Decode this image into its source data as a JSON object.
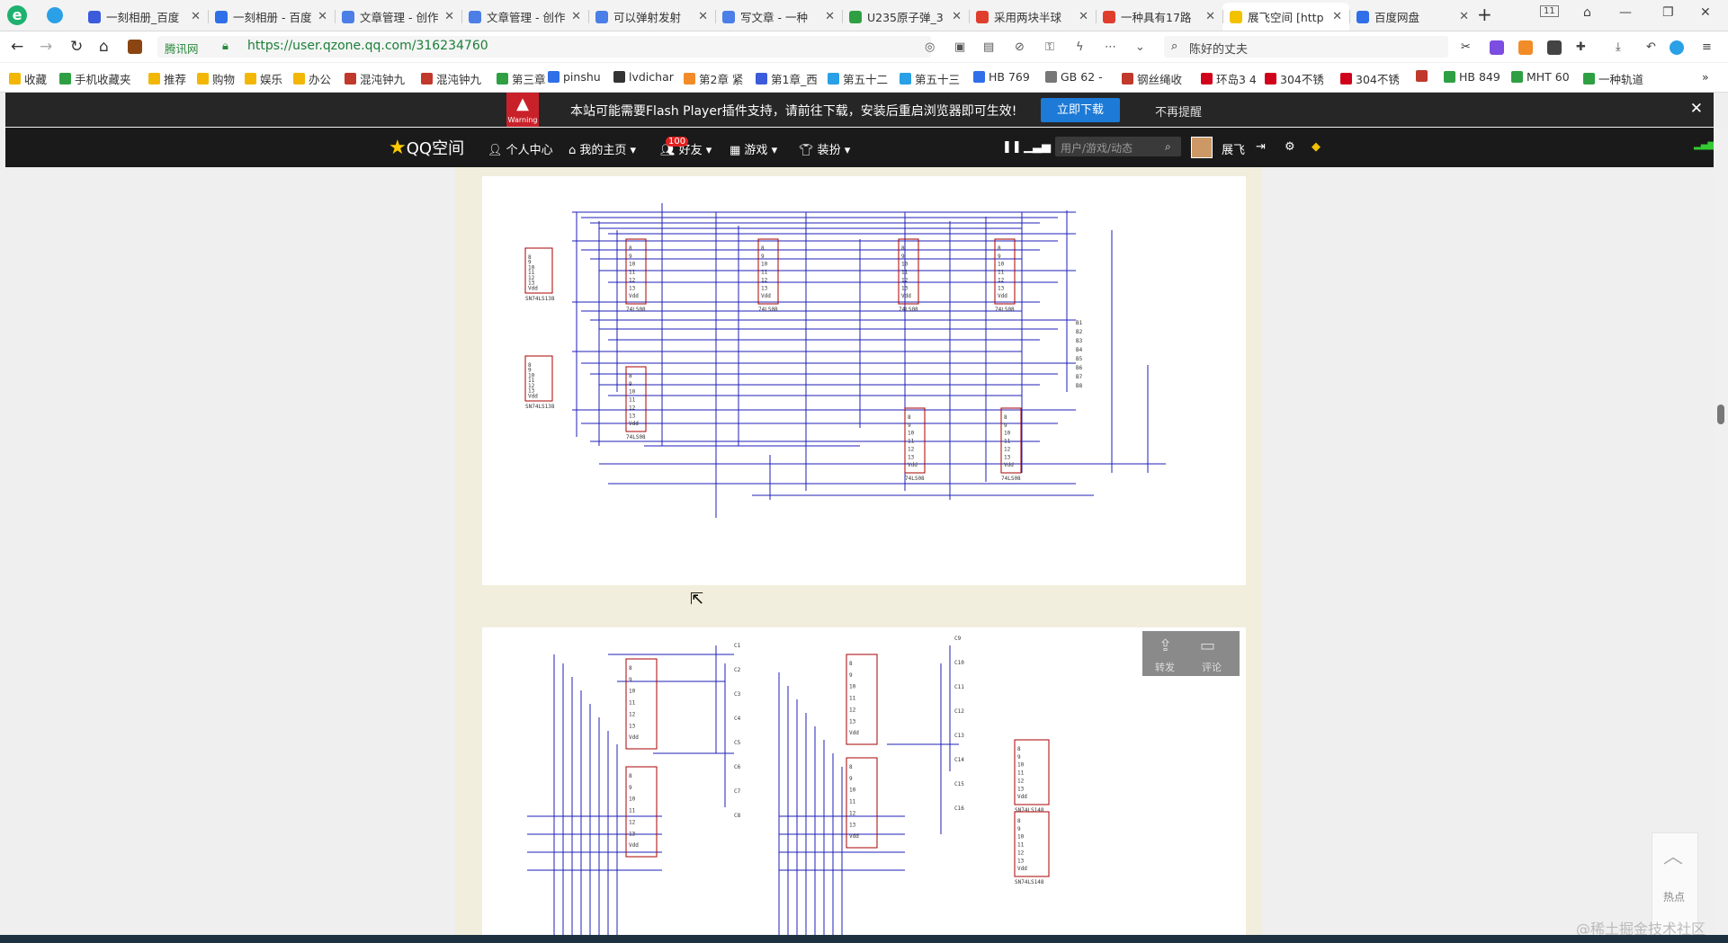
{
  "tabs": [
    {
      "title": "一刻相册_百度",
      "color": "#3b5bdb",
      "active": false
    },
    {
      "title": "一刻相册 - 百度",
      "color": "#2f6fe8",
      "active": false
    },
    {
      "title": "文章管理 - 创作",
      "color": "#4c7ee8",
      "active": false
    },
    {
      "title": "文章管理 - 创作",
      "color": "#4c7ee8",
      "active": false
    },
    {
      "title": "可以弹射发射",
      "color": "#4c7ee8",
      "active": false
    },
    {
      "title": "写文章 - 一种",
      "color": "#4c7ee8",
      "active": false
    },
    {
      "title": "U235原子弹_3",
      "color": "#2ea043",
      "active": false
    },
    {
      "title": "采用两块半球",
      "color": "#e03e2d",
      "active": false
    },
    {
      "title": "一种具有17路",
      "color": "#e03e2d",
      "active": false
    },
    {
      "title": "展飞空间 [http",
      "color": "#f2c200",
      "active": true
    },
    {
      "title": "百度网盘",
      "color": "#2f6fe8",
      "active": false
    }
  ],
  "tab_count_badge": "11",
  "address": {
    "site_name": "腾讯网",
    "url": "https://user.qzone.qq.com/316234760",
    "search_text": "陈好的丈夫"
  },
  "bookmarks": [
    {
      "label": "收藏",
      "color": "#f2b705"
    },
    {
      "label": "手机收藏夹",
      "color": "#2ea043"
    },
    {
      "label": "推荐",
      "color": "#f2b705"
    },
    {
      "label": "购物",
      "color": "#f2b705"
    },
    {
      "label": "娱乐",
      "color": "#f2b705"
    },
    {
      "label": "办公",
      "color": "#f2b705"
    },
    {
      "label": "混沌钟九",
      "color": "#c0392b"
    },
    {
      "label": "混沌钟九",
      "color": "#c0392b"
    },
    {
      "label": "第三章",
      "color": "#2ea043"
    },
    {
      "label": "pinshu",
      "color": "#2f6fe8"
    },
    {
      "label": "lvdichar",
      "color": "#333333"
    },
    {
      "label": "第2章 紧",
      "color": "#f28c28"
    },
    {
      "label": "第1章_西",
      "color": "#3b5bdb"
    },
    {
      "label": "第五十二",
      "color": "#2aa0e6"
    },
    {
      "label": "第五十三",
      "color": "#2aa0e6"
    },
    {
      "label": "HB 769",
      "color": "#2f6fe8"
    },
    {
      "label": "GB 62 -",
      "color": "#777777"
    },
    {
      "label": "钢丝绳收",
      "color": "#c0392b"
    },
    {
      "label": "环岛3 4",
      "color": "#d0021b"
    },
    {
      "label": "304不锈",
      "color": "#d0021b"
    },
    {
      "label": "304不锈",
      "color": "#d0021b"
    },
    {
      "label": "",
      "color": "#c0392b"
    },
    {
      "label": "HB 849",
      "color": "#2ea043"
    },
    {
      "label": "MHT 60",
      "color": "#2ea043"
    },
    {
      "label": "一种轨道",
      "color": "#2ea043"
    }
  ],
  "flash_bar": {
    "warning_label": "Warning",
    "message": "本站可能需要Flash Player插件支持，请前往下载，安装后重启浏览器即可生效!",
    "download_button": "立即下载",
    "dismiss_link": "不再提醒"
  },
  "qzone_nav": {
    "logo": "QQ空间",
    "items": [
      "个人中心",
      "我的主页",
      "好友",
      "游戏",
      "装扮"
    ],
    "friends_badge": "100",
    "search_placeholder": "用户/游戏/动态",
    "username": "展飞"
  },
  "post_actions": {
    "share": "转发",
    "comment": "评论"
  },
  "back_to_top": {
    "hot": "热点"
  },
  "watermark": "@稀土掘金技术社区",
  "schematic_top": {
    "decoders": [
      "SN74LS138",
      "SN74LS138"
    ],
    "chips": [
      "74LS08",
      "74LS08",
      "74LS08",
      "74LS08",
      "74LS08",
      "74LS08",
      "74LS08"
    ],
    "outputs": [
      "B1",
      "B2",
      "B3",
      "B4",
      "B5",
      "B6",
      "B7",
      "B8"
    ]
  },
  "schematic_bottom": {
    "left_outputs": [
      "C1",
      "C2",
      "C3",
      "C4",
      "C5",
      "C6",
      "C7",
      "C8"
    ],
    "right_outputs": [
      "C9",
      "C10",
      "C11",
      "C12",
      "C13",
      "C14",
      "C15",
      "C16"
    ],
    "encoders": [
      "SN74LS148",
      "SN74LS148"
    ]
  }
}
